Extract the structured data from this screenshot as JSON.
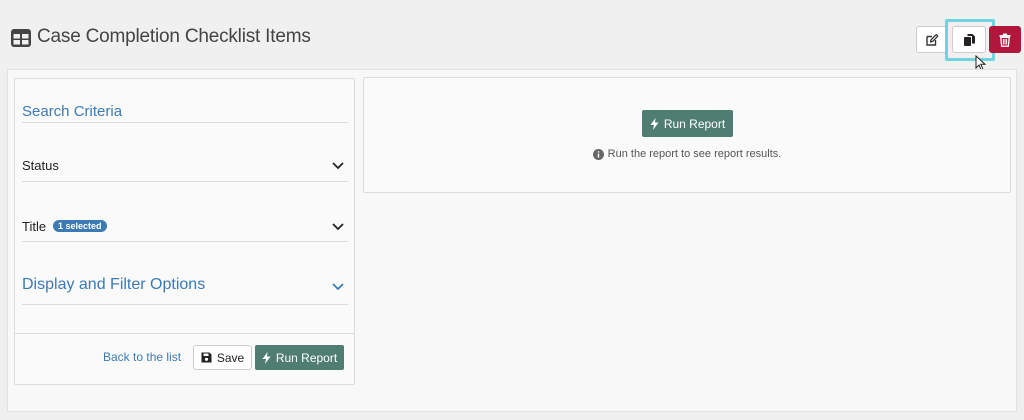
{
  "header": {
    "title": "Case Completion Checklist Items",
    "icons": {
      "title": "table-grid-icon",
      "edit": "edit-icon",
      "copy": "copy-icon",
      "delete": "trash-icon"
    }
  },
  "search": {
    "title": "Search Criteria",
    "status_label": "Status",
    "title_label": "Title",
    "title_badge": "1 selected",
    "display_options_label": "Display and Filter Options"
  },
  "footer": {
    "back_link": "Back to the list",
    "save_label": "Save",
    "run_label": "Run Report"
  },
  "results": {
    "run_label": "Run Report",
    "info_text": "Run the report to see report results."
  },
  "colors": {
    "accent": "#3b7ab5",
    "run_button": "#4f7d72",
    "delete_button": "#b0173a",
    "focus_ring": "#6fd3e0"
  }
}
